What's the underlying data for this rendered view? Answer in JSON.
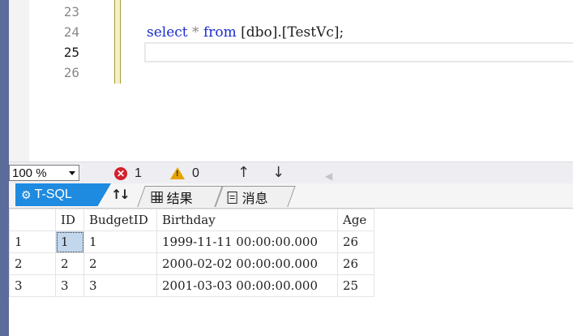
{
  "editor": {
    "lines": [
      {
        "number": "23",
        "code": ""
      },
      {
        "number": "24",
        "code": "select * from [dbo].[TestVc];"
      },
      {
        "number": "25",
        "code": ""
      },
      {
        "number": "26",
        "code": ""
      }
    ],
    "current_line": "25",
    "code_tokens": {
      "kw_select": "select",
      "star": "*",
      "kw_from": "from",
      "object": "[dbo].[TestVc];"
    }
  },
  "status": {
    "zoom": "100 %",
    "errors": "1",
    "warnings": "0",
    "nav_up": "↑",
    "nav_down": "↓",
    "nav_back": "◀"
  },
  "tabs": {
    "tsql": "T-SQL",
    "sort": "↑↓",
    "results": "结果",
    "messages": "消息"
  },
  "results": {
    "columns": [
      "",
      "ID",
      "BudgetID",
      "Birthday",
      "Age"
    ],
    "rows": [
      [
        "1",
        "1",
        "1",
        "1999-11-11 00:00:00.000",
        "26"
      ],
      [
        "2",
        "2",
        "2",
        "2000-02-02 00:00:00.000",
        "26"
      ],
      [
        "3",
        "3",
        "3",
        "2001-03-03 00:00:00.000",
        "25"
      ]
    ]
  },
  "colors": {
    "keyword": "#1a2ccc",
    "tsql_tab": "#1e8ae0",
    "selected_cell": "#c2d6ec",
    "error": "#d3202b",
    "warning": "#e6a300"
  }
}
